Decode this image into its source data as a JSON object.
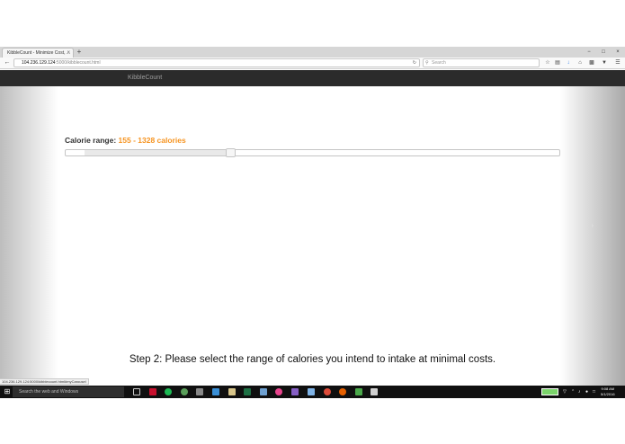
{
  "browser": {
    "tab_title": "KibbleCount - Minimize Cost, ...",
    "tab_close": "×",
    "new_tab": "+",
    "window_controls": {
      "minimize": "−",
      "maximize": "□",
      "close": "×"
    },
    "url_host": "104.236.129.124",
    "url_path": ":5000/kibblecount.html",
    "search_placeholder": "Search",
    "status_url": "104.236.129.124:5000/kibblecount.html#myCarousel"
  },
  "page": {
    "brand": "KibbleCount",
    "calorie_label": "Calorie range: ",
    "calorie_value": "155 - 1328 calories",
    "slider": {
      "min_fraction": 0.039,
      "max_fraction": 0.333
    },
    "step_text": "Step 2: Please select the range of calories you intend to intake at minimal costs.",
    "carousel_prev": "‹",
    "carousel_next": "›"
  },
  "taskbar": {
    "search_placeholder": "Search the web and Windows",
    "time": "9:08 AM",
    "date": "5/1/2016",
    "colors": {
      "spotify": "#1db954",
      "red_app": "#c8102e",
      "visual_studio": "#865fc5",
      "chrome": "#dd4b39",
      "firefox": "#e66000",
      "itunes": "#e8448d",
      "excel": "#1d7044"
    }
  },
  "colors": {
    "accent": "#f6931f",
    "header_bg": "#2b2b2b"
  }
}
